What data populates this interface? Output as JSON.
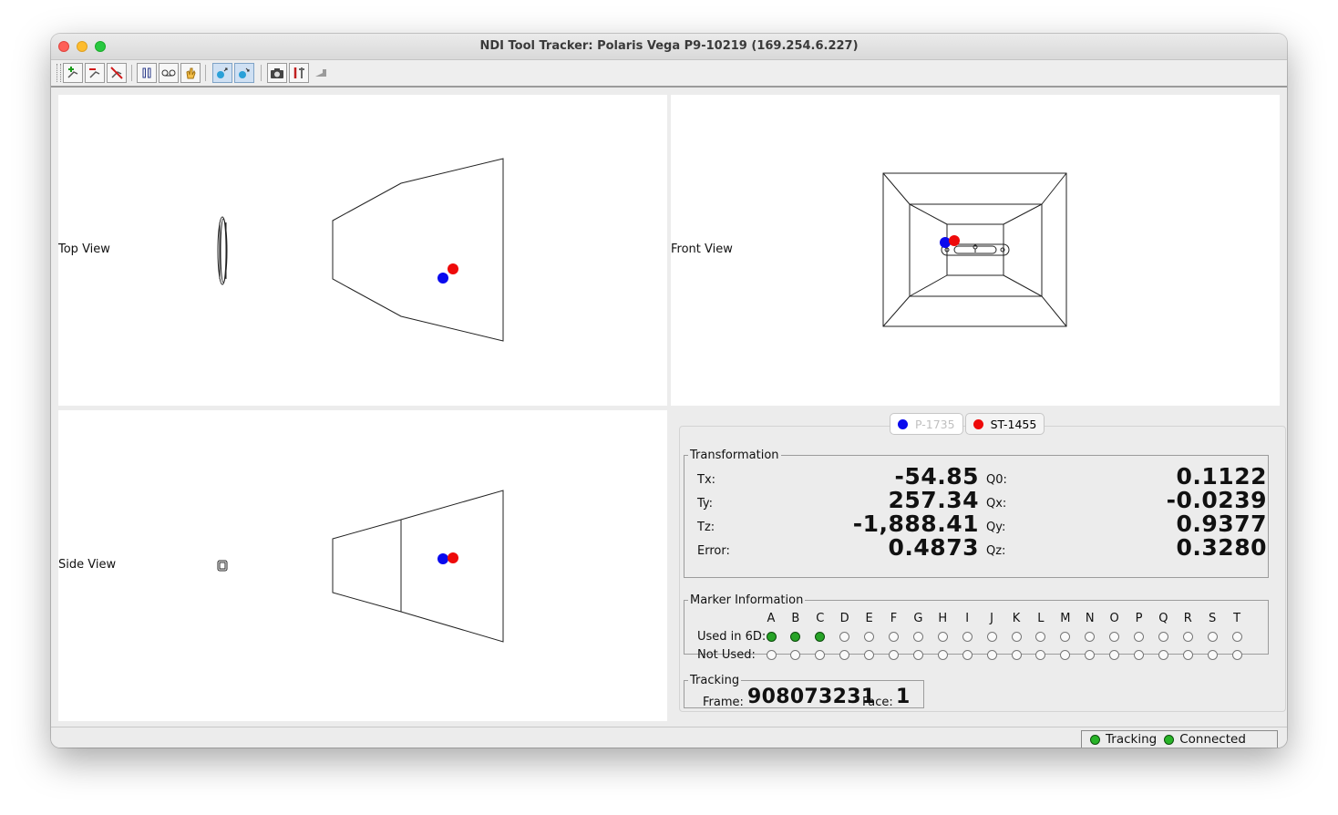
{
  "window": {
    "title": "NDI Tool Tracker: Polaris Vega P9-10219 (169.254.6.227)"
  },
  "toolbar": {
    "buttons": [
      {
        "icon": "add-tool-icon"
      },
      {
        "icon": "remove-tool-icon"
      },
      {
        "icon": "disable-tool-icon"
      },
      {
        "icon": "pause-icon"
      },
      {
        "icon": "record-icon"
      },
      {
        "icon": "hand-icon"
      },
      {
        "icon": "view-up-icon"
      },
      {
        "icon": "view-down-icon"
      },
      {
        "icon": "camera-icon"
      },
      {
        "icon": "tools-icon"
      },
      {
        "icon": "probe-icon"
      }
    ]
  },
  "views": {
    "top": "Top View",
    "front": "Front View",
    "side": "Side View"
  },
  "tools": [
    {
      "name": "P-1735",
      "color": "#1010ee",
      "enabled": false
    },
    {
      "name": "ST-1455",
      "color": "#ee1010",
      "enabled": true
    }
  ],
  "transformation": {
    "legend": "Transformation",
    "tx_label": "Tx:",
    "tx": "-54.85",
    "ty_label": "Ty:",
    "ty": "257.34",
    "tz_label": "Tz:",
    "tz": "-1,888.41",
    "error_label": "Error:",
    "error": "0.4873",
    "q0_label": "Q0:",
    "q0": "0.1122",
    "qx_label": "Qx:",
    "qx": "-0.0239",
    "qy_label": "Qy:",
    "qy": "0.9377",
    "qz_label": "Qz:",
    "qz": "0.3280"
  },
  "markers": {
    "legend": "Marker Information",
    "used_label": "Used in 6D:",
    "not_used_label": "Not Used:",
    "letters": [
      "A",
      "B",
      "C",
      "D",
      "E",
      "F",
      "G",
      "H",
      "I",
      "J",
      "K",
      "L",
      "M",
      "N",
      "O",
      "P",
      "Q",
      "R",
      "S",
      "T"
    ],
    "used": [
      true,
      true,
      true,
      false,
      false,
      false,
      false,
      false,
      false,
      false,
      false,
      false,
      false,
      false,
      false,
      false,
      false,
      false,
      false,
      false
    ],
    "not_used": [
      false,
      false,
      false,
      false,
      false,
      false,
      false,
      false,
      false,
      false,
      false,
      false,
      false,
      false,
      false,
      false,
      false,
      false,
      false,
      false
    ]
  },
  "tracking": {
    "legend": "Tracking",
    "frame_label": "Frame:",
    "frame": "908073231",
    "face_label": "Face:",
    "face": "1"
  },
  "status": {
    "tracking": "Tracking",
    "connected": "Connected",
    "led_color": "#28b428"
  }
}
